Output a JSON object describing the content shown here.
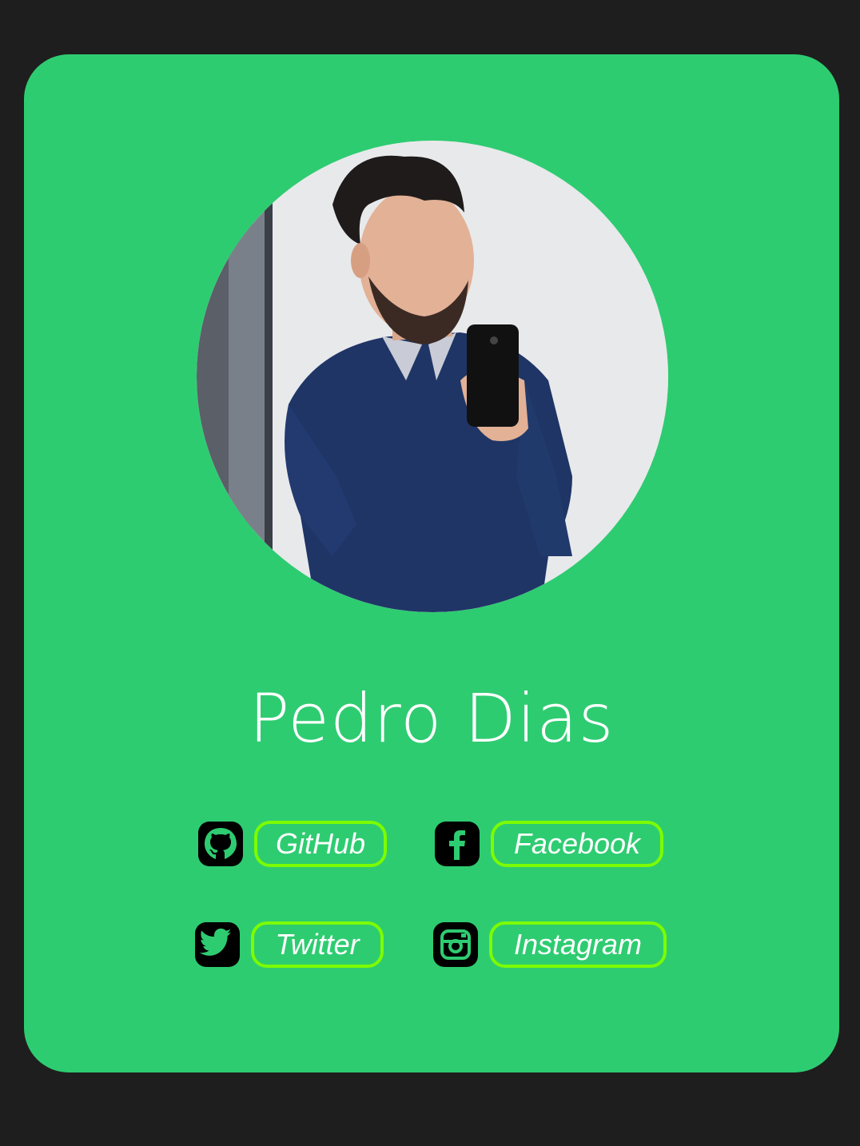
{
  "profile": {
    "name": "Pedro Dias",
    "photo_alt": "Profile photo"
  },
  "links": [
    {
      "label": "GitHub",
      "icon": "github-icon"
    },
    {
      "label": "Facebook",
      "icon": "facebook-icon"
    },
    {
      "label": "Twitter",
      "icon": "twitter-icon"
    },
    {
      "label": "Instagram",
      "icon": "instagram-icon"
    }
  ],
  "colors": {
    "page_background": "#1e1e1e",
    "card_background": "#2ecc71",
    "pill_border": "#7cfc00",
    "text": "#ffffff"
  }
}
